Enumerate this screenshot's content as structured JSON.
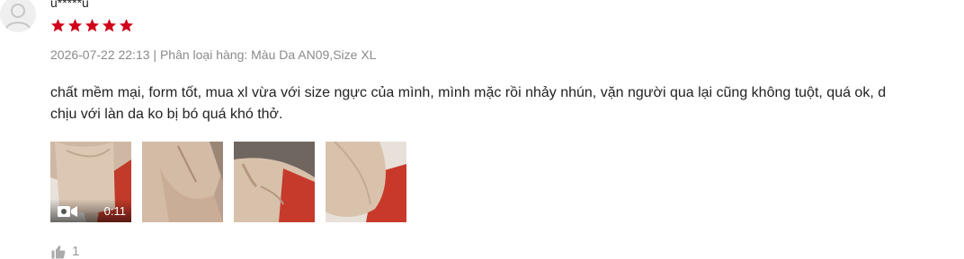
{
  "review": {
    "username": "u*****u",
    "rating": 5,
    "star_color": "#d0011b",
    "meta": "2026-07-22 22:13 | Phân loại hàng: Màu Da AN09,Size XL",
    "content_lines": [
      "chất mềm mại, form tốt, mua xl vừa với size ngực của mình, mình mặc rồi nhảy nhún, vặn người qua lại cũng không tuột, quá ok, d",
      "chịu với làn da ko bị bó quá khó thở."
    ],
    "media": {
      "video_duration": "0:11",
      "thumbnail_count": 4
    },
    "likes": "1"
  },
  "icons": {
    "avatar": "user-avatar-icon",
    "star": "star-icon",
    "video": "video-camera-icon",
    "like": "thumbs-up-icon"
  }
}
